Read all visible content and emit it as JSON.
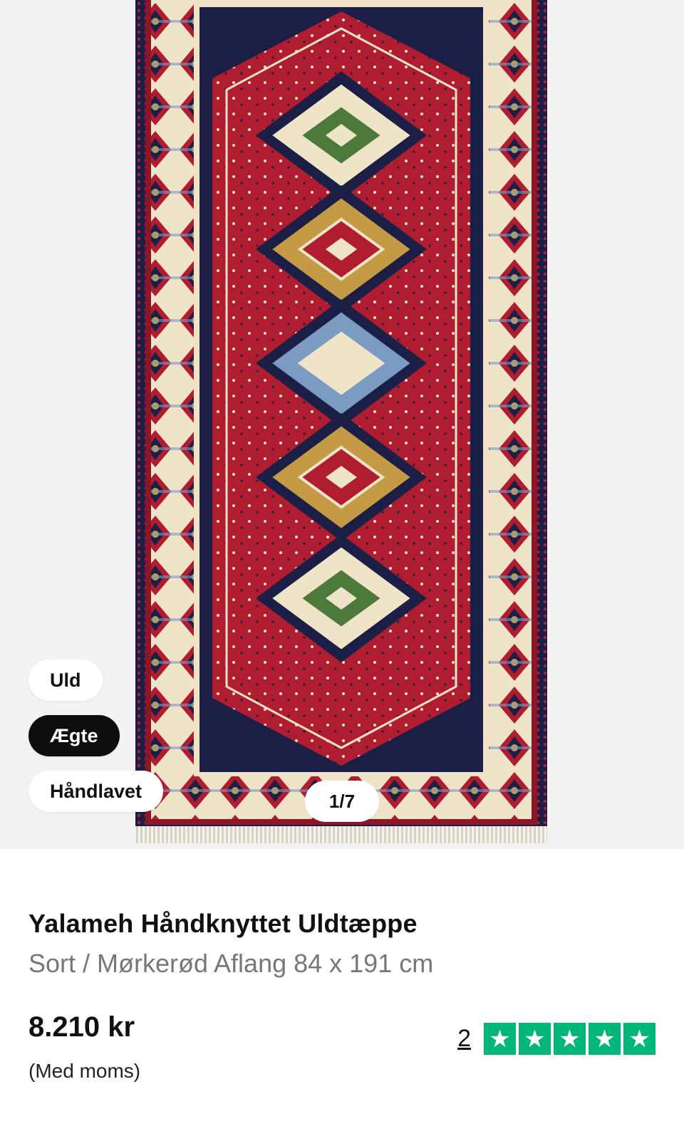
{
  "gallery": {
    "tags": [
      {
        "label": "Uld"
      },
      {
        "label": "Ægte"
      },
      {
        "label": "Håndlavet"
      }
    ],
    "counter": "1/7"
  },
  "product": {
    "title": "Yalameh Håndknyttet Uldtæppe",
    "subtitle": "Sort / Mørkerød Aflang 84 x 191 cm",
    "price": "8.210 kr",
    "vat_note": "(Med moms)"
  },
  "rating": {
    "count": "2",
    "stars": 5,
    "star_icon": "★",
    "star_color": "#00b67a"
  },
  "colors": {
    "rug_red": "#b01d30",
    "rug_navy": "#1b1f45",
    "rug_cream": "#efe4c8",
    "rug_gold": "#c49a45",
    "rug_blue": "#7b9cc2"
  }
}
